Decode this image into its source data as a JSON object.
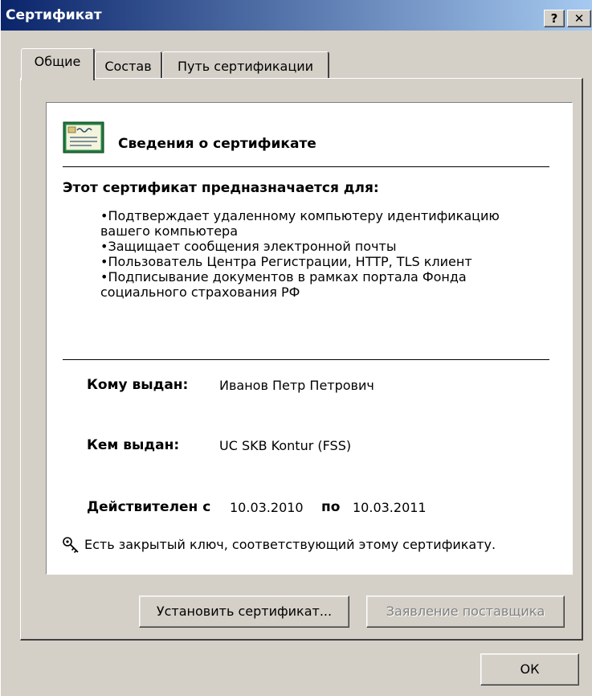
{
  "window": {
    "title": "Сертификат",
    "help_label": "?",
    "close_label": "✕"
  },
  "tabs": [
    {
      "label": "Общие",
      "active": true
    },
    {
      "label": "Состав",
      "active": false
    },
    {
      "label": "Путь сертификации",
      "active": false
    }
  ],
  "info": {
    "title": "Сведения о сертификате",
    "purpose_heading": "Этот сертификат предназначается для:",
    "purposes": [
      "•Подтверждает удаленному компьютеру идентификацию вашего компьютера",
      "•Защищает сообщения электронной почты",
      "•Пользователь Центра Регистрации, HTTP, TLS клиент",
      "•Подписывание документов в рамках портала Фонда социального страхования РФ"
    ],
    "issued_to_label": "Кому выдан:",
    "issued_to_value": "Иванов Петр Петрович",
    "issued_by_label": "Кем выдан:",
    "issued_by_value": "UC SKB Kontur (FSS)",
    "valid_from_label": "Действителен с",
    "valid_from": "10.03.2010",
    "valid_to_label": "по",
    "valid_to": "10.03.2011",
    "private_key_note": "Есть закрытый ключ, соответствующий этому сертификату."
  },
  "buttons": {
    "install": "Установить сертификат...",
    "issuer_statement": "Заявление поставщика",
    "ok": "ОК"
  },
  "colors": {
    "title_start": "#0a246a",
    "title_end": "#a6caf0",
    "face": "#d4d0c8"
  }
}
